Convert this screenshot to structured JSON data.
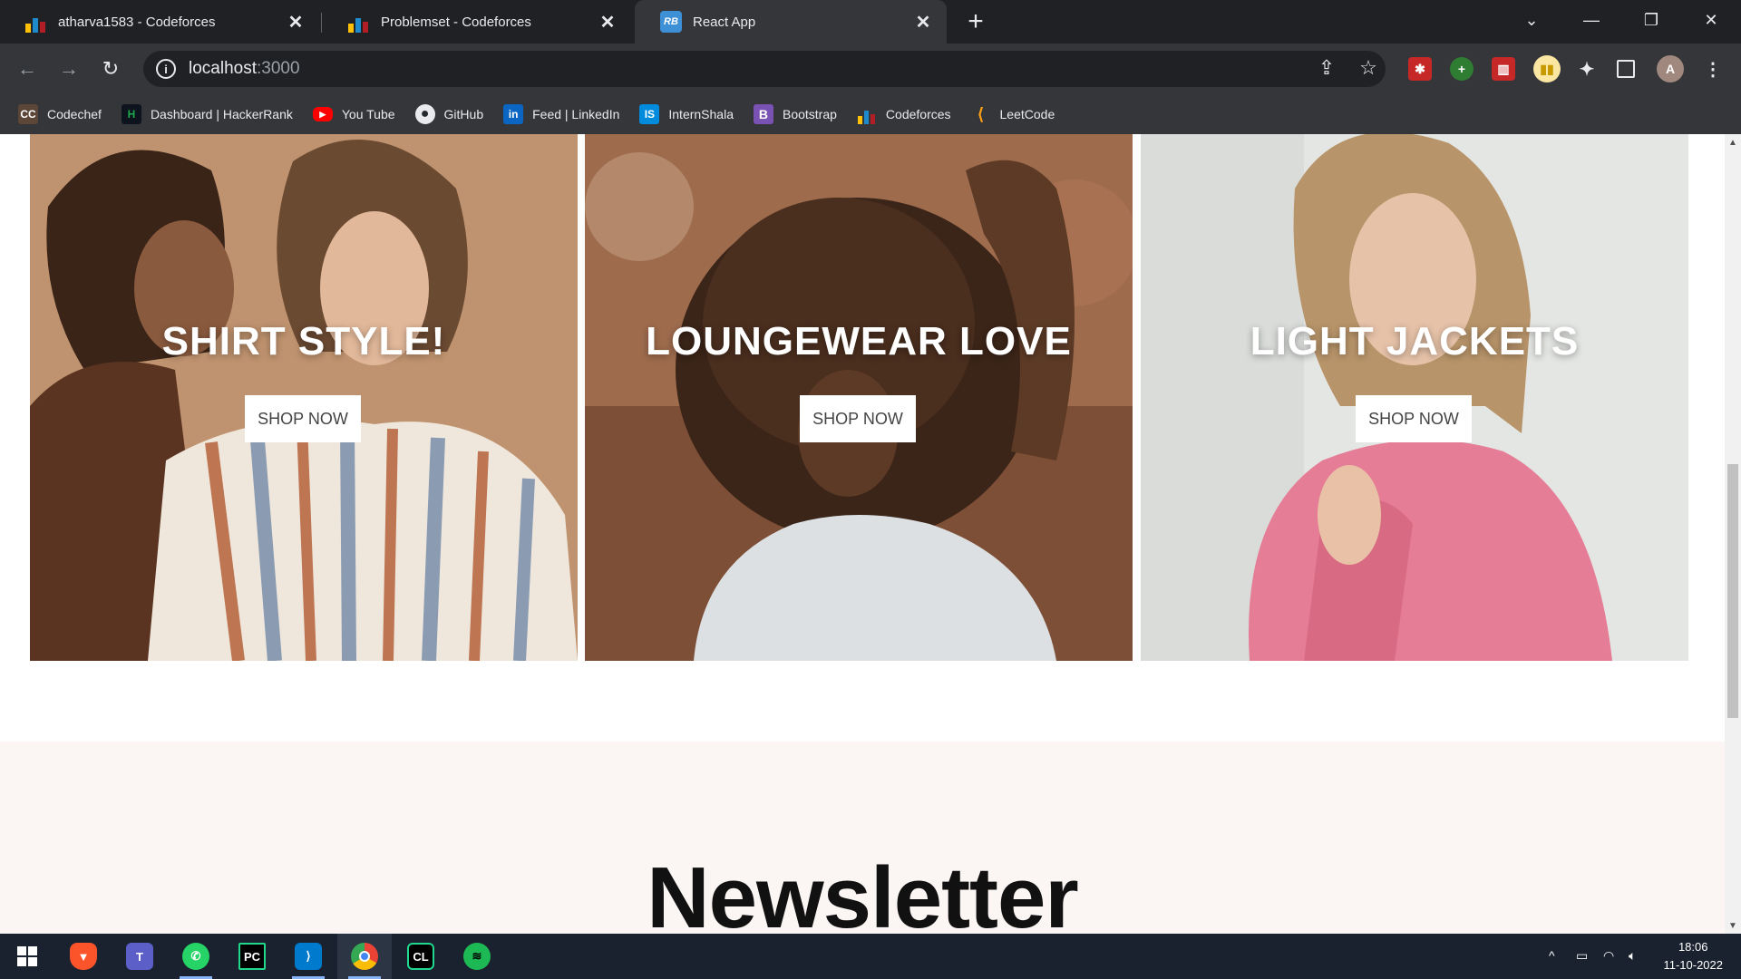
{
  "tabs": [
    {
      "title": "atharva1583 - Codeforces",
      "favicon": "codeforces-icon"
    },
    {
      "title": "Problemset - Codeforces",
      "favicon": "codeforces-icon"
    },
    {
      "title": "React App",
      "favicon": "react-icon",
      "favicon_text": "RB"
    }
  ],
  "address": {
    "host": "localhost",
    "port": ":3000"
  },
  "bookmarks": [
    {
      "label": "Codechef",
      "icon": "codechef-icon",
      "icon_text": "CC",
      "color": "#5b4638"
    },
    {
      "label": "Dashboard | HackerRank",
      "icon": "hackerrank-icon",
      "icon_text": "H",
      "color": "#1ba94c"
    },
    {
      "label": "You Tube",
      "icon": "youtube-icon",
      "icon_text": "▶",
      "color": "#ff0000"
    },
    {
      "label": "GitHub",
      "icon": "github-icon",
      "icon_text": "●",
      "color": "#24292e"
    },
    {
      "label": "Feed | LinkedIn",
      "icon": "linkedin-icon",
      "icon_text": "in",
      "color": "#0a66c2"
    },
    {
      "label": "InternShala",
      "icon": "internshala-icon",
      "icon_text": "IS",
      "color": "#008bdc"
    },
    {
      "label": "Bootstrap",
      "icon": "bootstrap-icon",
      "icon_text": "B",
      "color": "#7952b3"
    },
    {
      "label": "Codeforces",
      "icon": "codeforces-icon",
      "icon_text": "",
      "color": "#1f8acb"
    },
    {
      "label": "LeetCode",
      "icon": "leetcode-icon",
      "icon_text": "⟨",
      "color": "#ffa116"
    }
  ],
  "cards": [
    {
      "heading": "SHIRT STYLE!",
      "button": "SHOP NOW"
    },
    {
      "heading": "LOUNGEWEAR LOVE",
      "button": "SHOP NOW"
    },
    {
      "heading": "LIGHT JACKETS",
      "button": "SHOP NOW"
    }
  ],
  "newsletter": {
    "title": "Newsletter"
  },
  "profile": {
    "initial": "A"
  },
  "clock": {
    "time": "18:06",
    "date": "11-10-2022"
  }
}
